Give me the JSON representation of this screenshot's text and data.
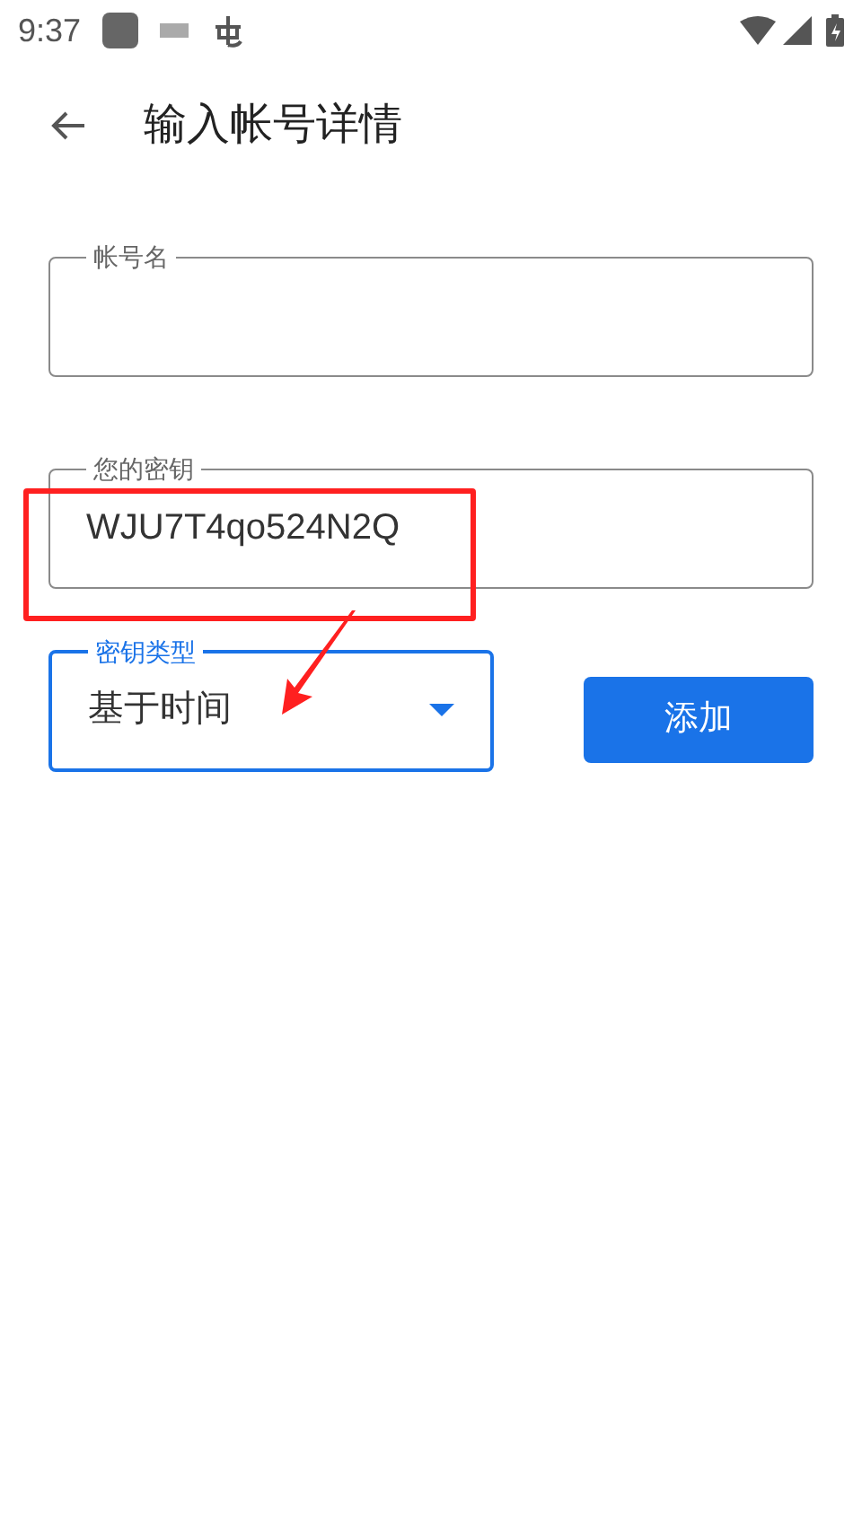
{
  "status_bar": {
    "time": "9:37"
  },
  "app_bar": {
    "title": "输入帐号详情"
  },
  "fields": [
    {
      "label": "帐号名",
      "focused": false
    },
    {
      "label": "您的密钥",
      "value": "WJU7T4qo524N2Q",
      "focused": false
    }
  ],
  "key_type": {
    "label": "密钥类型",
    "value": "基于时间",
    "focused": true
  },
  "add_button": {
    "label": "添加"
  },
  "annotation": {
    "highlight": true
  }
}
